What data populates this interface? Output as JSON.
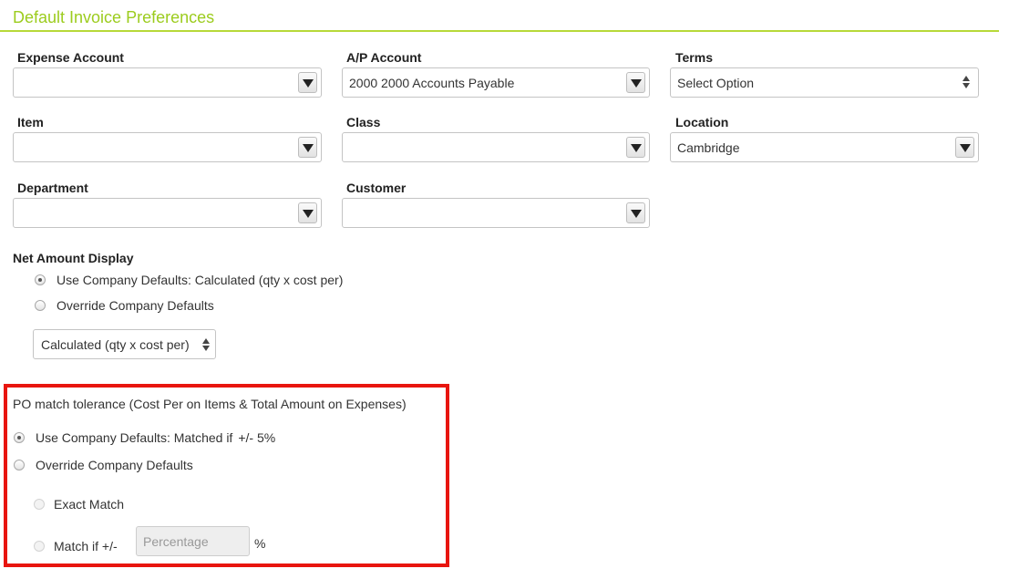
{
  "section": {
    "title": "Default Invoice Preferences"
  },
  "fields": {
    "expense_account": {
      "label": "Expense Account",
      "value": ""
    },
    "ap_account": {
      "label": "A/P Account",
      "value": "2000 2000 Accounts Payable"
    },
    "terms": {
      "label": "Terms",
      "value": "Select Option"
    },
    "item": {
      "label": "Item",
      "value": ""
    },
    "class": {
      "label": "Class",
      "value": ""
    },
    "location": {
      "label": "Location",
      "value": "Cambridge"
    },
    "department": {
      "label": "Department",
      "value": ""
    },
    "customer": {
      "label": "Customer",
      "value": ""
    }
  },
  "net_amount": {
    "label": "Net Amount Display",
    "options": [
      {
        "label": "Use Company Defaults: Calculated (qty x cost per)",
        "checked": true
      },
      {
        "label": "Override Company Defaults",
        "checked": false
      }
    ],
    "override_select_value": "Calculated (qty x cost per)"
  },
  "po_tolerance": {
    "label": "PO match tolerance (Cost Per on Items & Total Amount on Expenses)",
    "options": [
      {
        "label": "Use Company Defaults: Matched if",
        "suffix": "+/- 5%",
        "checked": true
      },
      {
        "label": "Override Company Defaults",
        "checked": false
      }
    ],
    "sub_options": [
      {
        "label": "Exact Match",
        "checked": false,
        "disabled": true
      },
      {
        "label": "Match if +/-",
        "checked": false,
        "disabled": true
      }
    ],
    "percentage_placeholder": "Percentage",
    "percent_sign": "%"
  },
  "colors": {
    "accent": "#9ccc1e",
    "highlight": "#e8150f"
  }
}
